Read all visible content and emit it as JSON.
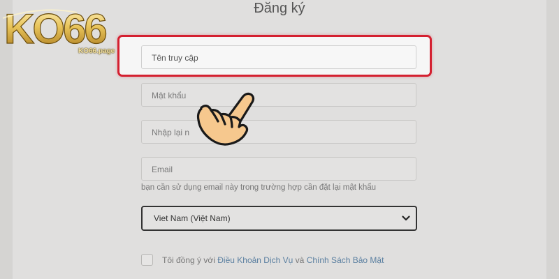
{
  "brand": {
    "logo_text": "KO66",
    "domain": "KO66.page"
  },
  "form": {
    "title": "Đăng ký",
    "username_placeholder": "Tên truy cập",
    "password_placeholder": "Mật khẩu",
    "confirm_password_placeholder": "Nhập lại mật khẩu",
    "confirm_password_visible_text": "Nhập lại n",
    "email_placeholder": "Email",
    "email_hint": "bạn cần sử dụng email này trong trường hợp cần đặt lại mật khẩu",
    "country_selected": "Viet Nam (Việt Nam)",
    "agree_prefix": "Tôi đồng ý với",
    "terms_link": "Điều Khoản Dịch Vụ",
    "and": "và",
    "privacy_link": "Chính Sách Bảo Mật"
  },
  "colors": {
    "highlight_border": "#d42030",
    "link": "#5a7fa0",
    "logo_gold": "#e8c45a",
    "hand_skin": "#f6c88e"
  },
  "icons": {
    "hand": "pointing-hand-icon",
    "select_arrow": "chevron-down-icon"
  }
}
